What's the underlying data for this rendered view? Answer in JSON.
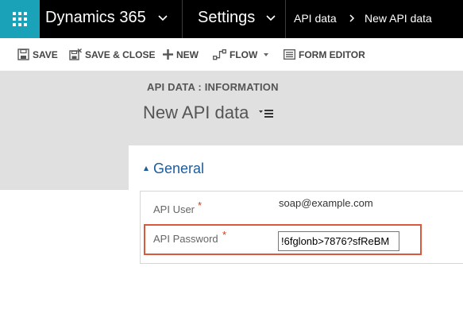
{
  "topnav": {
    "app_title": "Dynamics 365",
    "area_title": "Settings",
    "breadcrumb": [
      "API data",
      "New API data"
    ]
  },
  "commands": [
    {
      "label": "SAVE",
      "icon": "save-icon"
    },
    {
      "label": "SAVE & CLOSE",
      "icon": "save-close-icon"
    },
    {
      "label": "NEW",
      "icon": "plus-icon"
    },
    {
      "label": "FLOW",
      "icon": "flow-icon"
    },
    {
      "label": "FORM EDITOR",
      "icon": "form-editor-icon"
    }
  ],
  "header": {
    "entity_label": "API DATA : INFORMATION",
    "record_title": "New API data"
  },
  "form": {
    "section_title": "General",
    "fields": [
      {
        "label": "API User",
        "required_mark": "*",
        "value": "soap@example.com"
      },
      {
        "label": "API Password",
        "required_mark": "*",
        "value": "!6fglonb>7876?sfReBM"
      }
    ]
  },
  "colors": {
    "brand_teal": "#1aa2b8",
    "nav_black": "#000000",
    "section_blue": "#1e5b99",
    "highlight_red": "#d9593f",
    "required_red": "#d43b0e"
  }
}
